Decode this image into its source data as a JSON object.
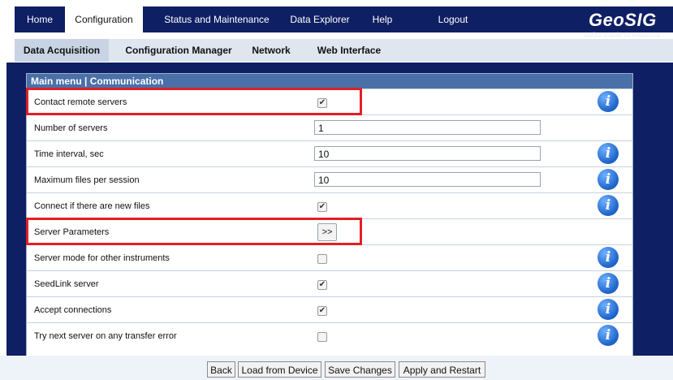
{
  "top_nav": {
    "tabs": [
      {
        "label": "Home",
        "active": false
      },
      {
        "label": "Configuration",
        "active": true
      },
      {
        "label": "Status and Maintenance",
        "active": false
      },
      {
        "label": "Data Explorer",
        "active": false
      },
      {
        "label": "Help",
        "active": false
      },
      {
        "label": "Logout",
        "active": false
      }
    ]
  },
  "logo": {
    "word": "GeoSIG",
    "tagline": "swiss made to measure"
  },
  "sub_nav": {
    "tabs": [
      {
        "label": "Data Acquisition",
        "active": true
      },
      {
        "label": "Configuration Manager",
        "active": false
      },
      {
        "label": "Network",
        "active": false
      },
      {
        "label": "Web Interface",
        "active": false
      }
    ]
  },
  "panel": {
    "title": "Main menu | Communication",
    "rows": [
      {
        "label": "Contact remote servers",
        "control": "checkbox",
        "checked": true,
        "info": true,
        "highlighted": true
      },
      {
        "label": "Number of servers",
        "control": "text",
        "value": "1",
        "info": false,
        "highlighted": false
      },
      {
        "label": "Time interval, sec",
        "control": "text",
        "value": "10",
        "info": true,
        "highlighted": false
      },
      {
        "label": "Maximum files per session",
        "control": "text",
        "value": "10",
        "info": true,
        "highlighted": false
      },
      {
        "label": "Connect if there are new files",
        "control": "checkbox",
        "checked": true,
        "info": true,
        "highlighted": false
      },
      {
        "label": "Server Parameters",
        "control": "button",
        "value": ">>",
        "info": false,
        "highlighted": true
      },
      {
        "label": "Server mode for other instruments",
        "control": "checkbox",
        "checked": false,
        "info": true,
        "highlighted": false
      },
      {
        "label": "SeedLink server",
        "control": "checkbox",
        "checked": true,
        "info": true,
        "highlighted": false
      },
      {
        "label": "Accept connections",
        "control": "checkbox",
        "checked": true,
        "info": true,
        "highlighted": false
      },
      {
        "label": "Try next server on any transfer error",
        "control": "checkbox",
        "checked": false,
        "info": true,
        "highlighted": false
      }
    ]
  },
  "footer": {
    "back": "Back",
    "load": "Load from Device",
    "save": "Save Changes",
    "apply": "Apply and Restart"
  },
  "icons": {
    "info": "info-icon",
    "checkbox_check": "check-icon"
  },
  "colors": {
    "nav_bg": "#0f1f64",
    "panel_head": "#4a70a8",
    "highlight": "#e01f26",
    "info": "#1c63c8"
  }
}
